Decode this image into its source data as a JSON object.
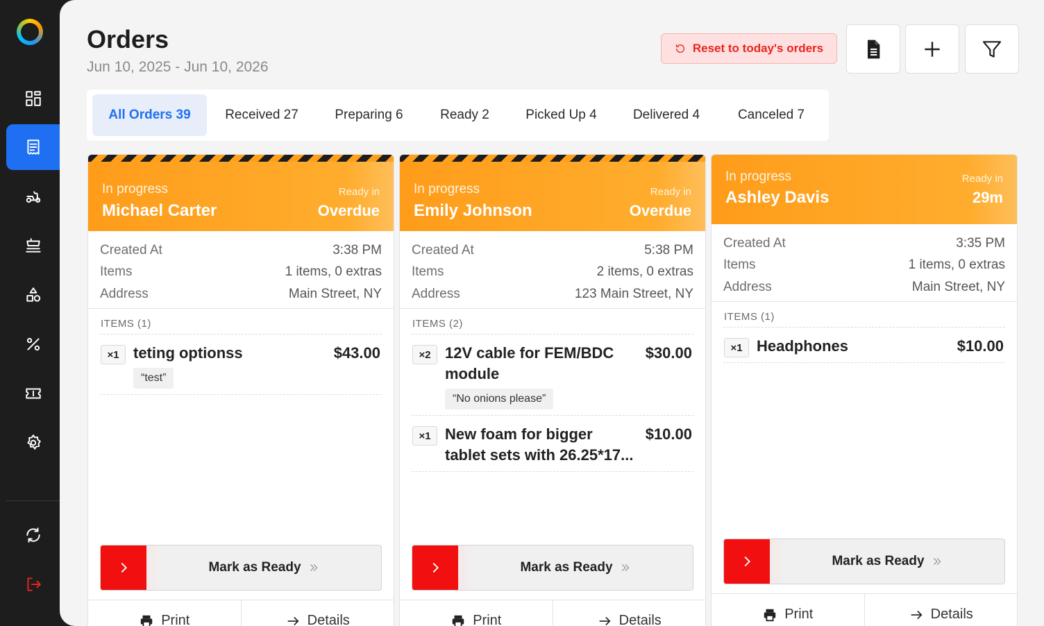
{
  "header": {
    "title": "Orders",
    "date_range": "Jun 10, 2025 - Jun 10, 2026",
    "reset_label": "Reset to today's orders"
  },
  "tabs": [
    {
      "label": "All Orders 39",
      "active": true
    },
    {
      "label": "Received 27"
    },
    {
      "label": "Preparing 6"
    },
    {
      "label": "Ready 2"
    },
    {
      "label": "Picked Up 4"
    },
    {
      "label": "Delivered 4"
    },
    {
      "label": "Canceled 7"
    }
  ],
  "labels": {
    "created_at": "Created At",
    "items": "Items",
    "address": "Address",
    "ready_in": "Ready in",
    "mark_ready": "Mark as Ready",
    "print": "Print",
    "details": "Details"
  },
  "orders": [
    {
      "status": "In progress",
      "customer": "Michael Carter",
      "ready": "Overdue",
      "created_at": "3:38 PM",
      "items_summary": "1 items, 0 extras",
      "address": "Main Street, NY",
      "items_header": "ITEMS  (1)",
      "items": [
        {
          "qty": "×1",
          "name": "teting optionss",
          "price": "$43.00",
          "note": "“test”"
        }
      ]
    },
    {
      "status": "In progress",
      "customer": "Emily Johnson",
      "ready": "Overdue",
      "created_at": "5:38 PM",
      "items_summary": "2 items, 0 extras",
      "address": "123 Main Street, NY",
      "items_header": "ITEMS  (2)",
      "items": [
        {
          "qty": "×2",
          "name": "12V cable for FEM/BDC module",
          "price": "$30.00",
          "note": "“No onions please”"
        },
        {
          "qty": "×1",
          "name": "New foam for bigger tablet sets with 26.25*17...",
          "price": "$10.00"
        }
      ]
    },
    {
      "status": "In progress",
      "customer": "Ashley Davis",
      "ready": "29m",
      "created_at": "3:35 PM",
      "items_summary": "1 items, 0 extras",
      "address": "Main Street, NY",
      "items_header": "ITEMS  (1)",
      "items": [
        {
          "qty": "×1",
          "name": "Headphones",
          "price": "$10.00"
        }
      ]
    }
  ]
}
